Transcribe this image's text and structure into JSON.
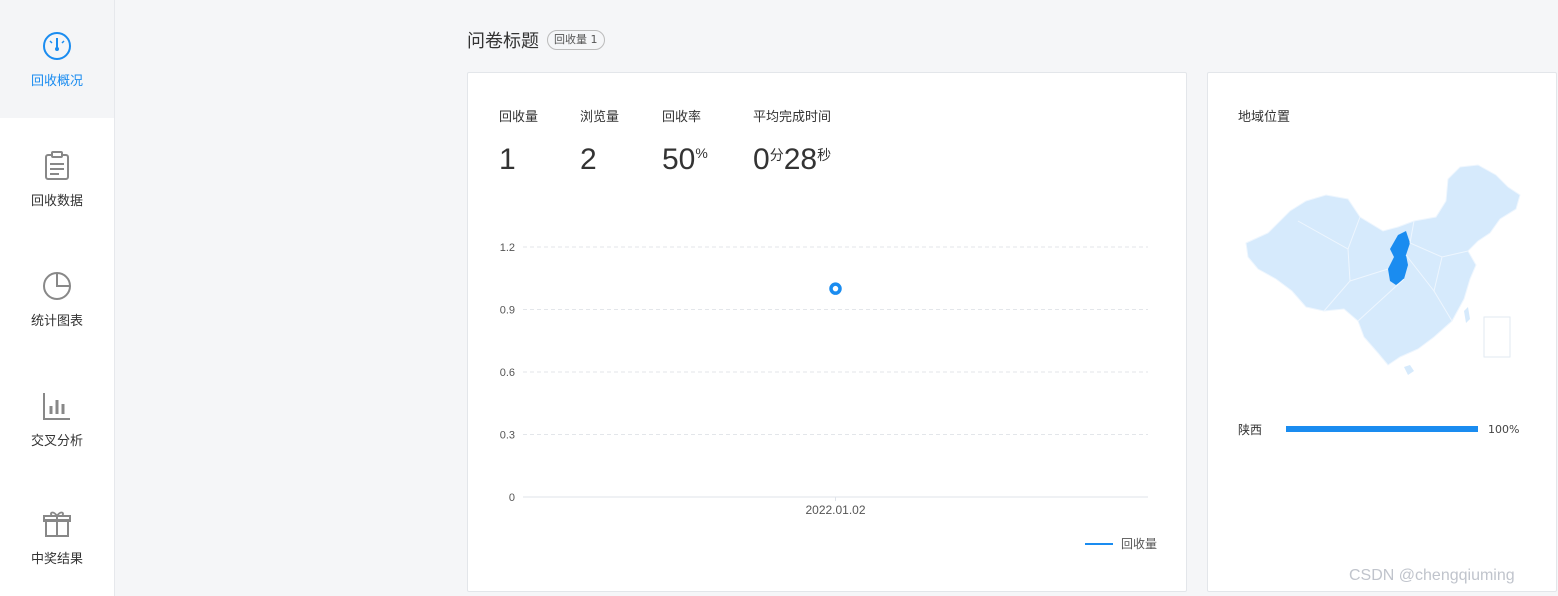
{
  "sidebar": {
    "items": [
      {
        "label": "回收概况",
        "icon": "gauge-icon",
        "active": true
      },
      {
        "label": "回收数据",
        "icon": "clipboard-icon",
        "active": false
      },
      {
        "label": "统计图表",
        "icon": "pie-chart-icon",
        "active": false
      },
      {
        "label": "交叉分析",
        "icon": "bar-chart-icon",
        "active": false
      },
      {
        "label": "中奖结果",
        "icon": "gift-icon",
        "active": false
      }
    ]
  },
  "header": {
    "title": "问卷标题",
    "badge": "回收量 1"
  },
  "stats": {
    "collect": {
      "label": "回收量",
      "value": "1"
    },
    "views": {
      "label": "浏览量",
      "value": "2"
    },
    "rate": {
      "label": "回收率",
      "value": "50",
      "unit": "%"
    },
    "avg_time": {
      "label": "平均完成时间",
      "minutes": "0",
      "minutes_unit": "分",
      "seconds": "28",
      "seconds_unit": "秒"
    }
  },
  "chart_data": {
    "type": "line",
    "categories": [
      "2022.01.02"
    ],
    "series": [
      {
        "name": "回收量",
        "values": [
          1
        ]
      }
    ],
    "ylim": [
      0,
      1.2
    ],
    "yticks": [
      "0",
      "0.3",
      "0.6",
      "0.9",
      "1.2"
    ],
    "grid": true,
    "legend": "bottom-right",
    "color": "#1a8cf0"
  },
  "map": {
    "title": "地域位置",
    "highlight_color": "#1a8cf0",
    "base_color": "#d6eafc",
    "regions": [
      {
        "name": "陕西",
        "percent": 100,
        "percent_label": "100%"
      }
    ]
  },
  "watermark": "CSDN @chengqiuming"
}
